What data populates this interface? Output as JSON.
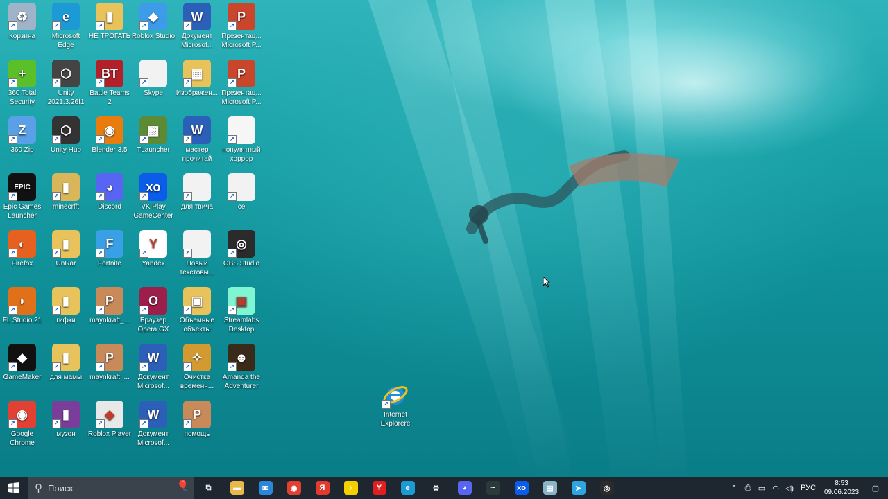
{
  "desktop": {
    "icons": [
      {
        "name": "recycle-bin",
        "label": "Корзина",
        "icon": "recycle-bin-icon",
        "color": "#9fb4c8",
        "glyph": "♻"
      },
      {
        "name": "microsoft-edge",
        "label": "Microsoft Edge",
        "icon": "edge-icon",
        "color": "#1c9ad6",
        "glyph": "e"
      },
      {
        "name": "ne-trogat",
        "label": "НЕ ТРОГАТЬ",
        "icon": "folder-icon",
        "color": "#e8c25a",
        "glyph": "▮"
      },
      {
        "name": "roblox-studio",
        "label": "Roblox Studio",
        "icon": "roblox-studio-icon",
        "color": "#3d9be9",
        "glyph": "◆"
      },
      {
        "name": "document-word-1",
        "label": "Документ Microsof...",
        "icon": "word-icon",
        "color": "#2b5fb8",
        "glyph": "W"
      },
      {
        "name": "presentation-1",
        "label": "Презентац... Microsoft P...",
        "icon": "powerpoint-icon",
        "color": "#c9452b",
        "glyph": "P"
      },
      {
        "name": "360-total-security",
        "label": "360 Total Security",
        "icon": "360-security-icon",
        "color": "#5bbf2a",
        "glyph": "+"
      },
      {
        "name": "unity-2021",
        "label": "Unity 2021.3.26f1",
        "icon": "unity-icon",
        "color": "#444444",
        "glyph": "⬡"
      },
      {
        "name": "battle-teams-2",
        "label": "Battle Teams 2",
        "icon": "battle-teams-icon",
        "color": "#b3202a",
        "glyph": "BT"
      },
      {
        "name": "skype",
        "label": "Skype",
        "icon": "file-icon",
        "color": "#f2f2f2",
        "glyph": ""
      },
      {
        "name": "images",
        "label": "Изображен...",
        "icon": "images-folder-icon",
        "color": "#e8c25a",
        "glyph": "▦"
      },
      {
        "name": "presentation-2",
        "label": "Презентац... Microsoft P...",
        "icon": "powerpoint-icon",
        "color": "#c9452b",
        "glyph": "P"
      },
      {
        "name": "360-zip",
        "label": "360 Zip",
        "icon": "zip-icon",
        "color": "#5aa0e6",
        "glyph": "Z"
      },
      {
        "name": "unity-hub",
        "label": "Unity Hub",
        "icon": "unity-hub-icon",
        "color": "#333333",
        "glyph": "⬡"
      },
      {
        "name": "blender",
        "label": "Blender 3.5",
        "icon": "blender-icon",
        "color": "#e87d0d",
        "glyph": "◉"
      },
      {
        "name": "tlauncher",
        "label": "TLauncher",
        "icon": "minecraft-icon",
        "color": "#5d8a35",
        "glyph": "▩"
      },
      {
        "name": "master-prochitai",
        "label": "мастер прочитай",
        "icon": "word-icon",
        "color": "#2b5fb8",
        "glyph": "W"
      },
      {
        "name": "popular-horror",
        "label": "популятный хоррор",
        "icon": "ppt-thumbnail-icon",
        "color": "#f6f6f6",
        "glyph": ""
      },
      {
        "name": "epic-games",
        "label": "Epic Games Launcher",
        "icon": "epic-games-icon",
        "color": "#111111",
        "glyph": "EPIC"
      },
      {
        "name": "minecrfft",
        "label": "minecrfft",
        "icon": "folder-icon",
        "color": "#d9b65a",
        "glyph": "▮"
      },
      {
        "name": "discord",
        "label": "Discord",
        "icon": "discord-icon",
        "color": "#5865f2",
        "glyph": "◕"
      },
      {
        "name": "vk-play",
        "label": "VK Play GameCenter",
        "icon": "vk-play-icon",
        "color": "#0b5ce8",
        "glyph": "xo"
      },
      {
        "name": "for-twitch",
        "label": "для твича",
        "icon": "file-icon",
        "color": "#f2f2f2",
        "glyph": ""
      },
      {
        "name": "ce",
        "label": "се",
        "icon": "file-icon",
        "color": "#f2f2f2",
        "glyph": ""
      },
      {
        "name": "firefox",
        "label": "Firefox",
        "icon": "firefox-icon",
        "color": "#e66020",
        "glyph": "◐"
      },
      {
        "name": "unrar",
        "label": "UnRar",
        "icon": "folder-icon",
        "color": "#e8c25a",
        "glyph": "▮"
      },
      {
        "name": "fortnite",
        "label": "Fortnite",
        "icon": "fortnite-icon",
        "color": "#3aa0e6",
        "glyph": "F"
      },
      {
        "name": "yandex",
        "label": "Yandex",
        "icon": "yandex-icon",
        "color": "#ffffff",
        "glyph": "Y"
      },
      {
        "name": "new-text",
        "label": "Новый текстовы...",
        "icon": "file-icon",
        "color": "#f2f2f2",
        "glyph": ""
      },
      {
        "name": "obs-studio",
        "label": "OBS Studio",
        "icon": "obs-icon",
        "color": "#2b2b2b",
        "glyph": "◎"
      },
      {
        "name": "fl-studio",
        "label": "FL Studio 21",
        "icon": "fl-studio-icon",
        "color": "#e0701a",
        "glyph": "◗"
      },
      {
        "name": "gifki",
        "label": "гифки",
        "icon": "folder-icon",
        "color": "#e8c25a",
        "glyph": "▮"
      },
      {
        "name": "maynkraft-1",
        "label": "maynkraft_...",
        "icon": "ppt-thumbnail-icon",
        "color": "#c98a5a",
        "glyph": "P"
      },
      {
        "name": "opera-gx",
        "label": "Браузер Opera GX",
        "icon": "opera-gx-icon",
        "color": "#9b1f4a",
        "glyph": "O"
      },
      {
        "name": "3d-objects",
        "label": "Объемные объекты",
        "icon": "3d-folder-icon",
        "color": "#e8c25a",
        "glyph": "▣"
      },
      {
        "name": "streamlabs",
        "label": "Streamlabs Desktop",
        "icon": "streamlabs-icon",
        "color": "#80f5d2",
        "glyph": "▣"
      },
      {
        "name": "gamemaker",
        "label": "GameMaker",
        "icon": "gamemaker-icon",
        "color": "#111111",
        "glyph": "◆"
      },
      {
        "name": "for-mom",
        "label": "для мамы",
        "icon": "folder-icon",
        "color": "#e8c25a",
        "glyph": "▮"
      },
      {
        "name": "maynkraft-2",
        "label": "maynkraft_...",
        "icon": "ppt-thumbnail-icon",
        "color": "#c98a5a",
        "glyph": "P"
      },
      {
        "name": "document-word-2",
        "label": "Документ Microsof...",
        "icon": "word-icon",
        "color": "#2b5fb8",
        "glyph": "W"
      },
      {
        "name": "disk-cleanup",
        "label": "Очистка временн...",
        "icon": "broom-icon",
        "color": "#d49a32",
        "glyph": "✧"
      },
      {
        "name": "amanda",
        "label": "Amanda the Adventurer",
        "icon": "amanda-icon",
        "color": "#3a2a1a",
        "glyph": "☻"
      },
      {
        "name": "google-chrome",
        "label": "Google Chrome",
        "icon": "chrome-icon",
        "color": "#e24033",
        "glyph": "◉"
      },
      {
        "name": "muzon",
        "label": "музон",
        "icon": "folder-icon",
        "color": "#7a3e9a",
        "glyph": "▮"
      },
      {
        "name": "roblox-player",
        "label": "Roblox Player",
        "icon": "roblox-icon",
        "color": "#e8e8e8",
        "glyph": "◆"
      },
      {
        "name": "document-word-3",
        "label": "Документ Microsof...",
        "icon": "word-icon",
        "color": "#2b5fb8",
        "glyph": "W"
      },
      {
        "name": "pomosch",
        "label": "помощь",
        "icon": "ppt-thumbnail-icon",
        "color": "#c98a5a",
        "glyph": "P"
      }
    ],
    "ie_icon": {
      "label": "Internet Explorere",
      "icon": "internet-explorer-icon"
    }
  },
  "taskbar": {
    "search_placeholder": "Поиск",
    "apps": [
      {
        "name": "task-view",
        "icon": "task-view-icon",
        "color": "#1e2630",
        "glyph": "⧉"
      },
      {
        "name": "file-explorer",
        "icon": "file-explorer-icon",
        "color": "#e8b84a",
        "glyph": "▬"
      },
      {
        "name": "mail",
        "icon": "mail-icon",
        "color": "#2b88d8",
        "glyph": "✉"
      },
      {
        "name": "chrome",
        "icon": "chrome-icon",
        "color": "#e24033",
        "glyph": "◉"
      },
      {
        "name": "yandex-browser",
        "icon": "yandex-browser-icon",
        "color": "#e23b2e",
        "glyph": "Я"
      },
      {
        "name": "ya-music",
        "icon": "yandex-music-icon",
        "color": "#f5d000",
        "glyph": "♪"
      },
      {
        "name": "yandex",
        "icon": "yandex-icon",
        "color": "#e02020",
        "glyph": "Y"
      },
      {
        "name": "edge",
        "icon": "edge-icon",
        "color": "#1c9ad6",
        "glyph": "e"
      },
      {
        "name": "settings",
        "icon": "gear-icon",
        "color": "#1e2630",
        "glyph": "⚙"
      },
      {
        "name": "discord",
        "icon": "discord-icon",
        "color": "#5865f2",
        "glyph": "◕"
      },
      {
        "name": "terminal",
        "icon": "terminal-icon",
        "color": "#2a3a3a",
        "glyph": "~"
      },
      {
        "name": "vk-play",
        "icon": "vk-play-icon",
        "color": "#0b5ce8",
        "glyph": "xo"
      },
      {
        "name": "notepad",
        "icon": "notepad-icon",
        "color": "#8ab4c8",
        "glyph": "▤"
      },
      {
        "name": "telegram",
        "icon": "telegram-icon",
        "color": "#2ca5e0",
        "glyph": "➤"
      },
      {
        "name": "obs",
        "icon": "obs-icon",
        "color": "#2b2b2b",
        "glyph": "◎"
      }
    ],
    "tray": {
      "language": "РУС",
      "time": "8:53",
      "date": "09.06.2023"
    }
  }
}
